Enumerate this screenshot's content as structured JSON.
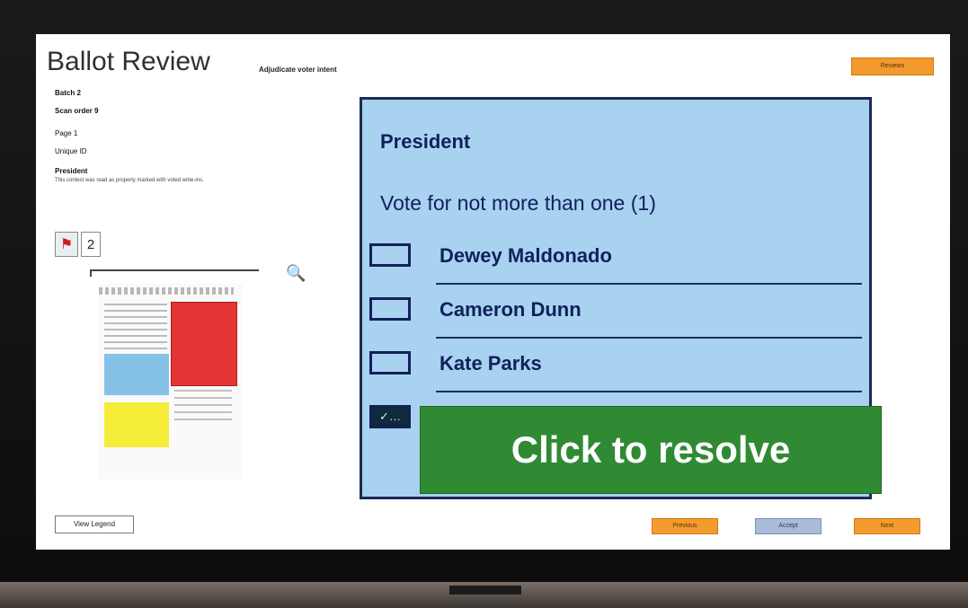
{
  "header": {
    "title": "Ballot Review",
    "subtitle": "Adjudicate voter intent",
    "top_action_label": "Reviews"
  },
  "ballot_meta": {
    "batch": "Batch 2",
    "scan_order": "Scan order 9",
    "page": "Page 1",
    "unique_id": "Unique ID",
    "contest": "President",
    "contest_note": "This contest was read as properly marked with voted write-ins."
  },
  "thumbnail_counter": {
    "icon": "flag-icon",
    "value": "2"
  },
  "contest": {
    "title": "President",
    "instruction": "Vote for not more than one (1)",
    "candidates": [
      {
        "name": "Dewey Maldonado",
        "marked": false
      },
      {
        "name": "Cameron Dunn",
        "marked": false
      },
      {
        "name": "Kate Parks",
        "marked": false
      },
      {
        "name": "",
        "marked": true
      }
    ]
  },
  "resolve_banner": {
    "label": "Click to resolve",
    "color": "#2f8a33"
  },
  "footer": {
    "legend_label": "View Legend",
    "previous_label": "Previous",
    "accept_label": "Accept",
    "next_label": "Next"
  },
  "colors": {
    "accent": "#f29a2e",
    "panel": "#a8d2ef",
    "panel_border": "#1c2a55"
  }
}
